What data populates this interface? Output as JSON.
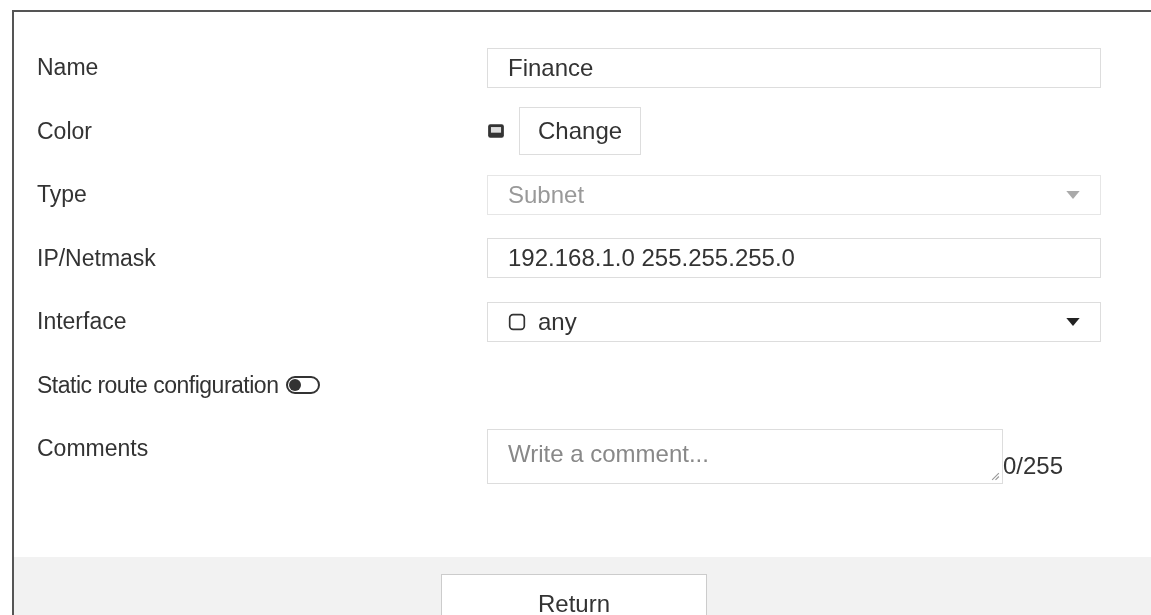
{
  "fields": [
    {
      "kind": "text",
      "label": "Name",
      "value": "Finance"
    },
    {
      "kind": "color",
      "label": "Color",
      "button": "Change"
    },
    {
      "kind": "select",
      "label": "Type",
      "value": "Subnet",
      "disabled": true
    },
    {
      "kind": "text",
      "label": "IP/Netmask",
      "value": "192.168.1.0 255.255.255.0"
    },
    {
      "kind": "interface",
      "label": "Interface",
      "value": "any",
      "disabled": false
    },
    {
      "kind": "toggle",
      "label": "Static route configuration",
      "on": false
    },
    {
      "kind": "textarea",
      "label": "Comments",
      "placeholder": "Write a comment...",
      "counter": "0/255"
    }
  ],
  "footer": {
    "button": "Return"
  }
}
